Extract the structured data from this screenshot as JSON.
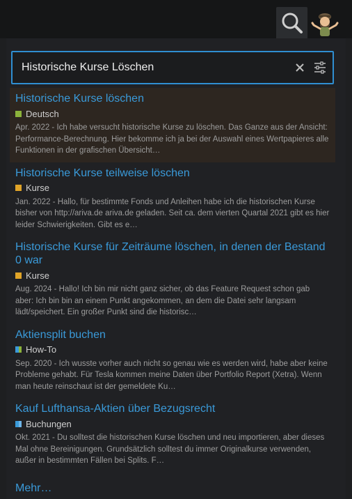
{
  "search": {
    "value": "Historische Kurse Löschen",
    "placeholder": ""
  },
  "colors": {
    "accent": "#2f8fd2",
    "link": "#3a9ad9",
    "cat_deutsch": "#8cb33b",
    "cat_kurse": "#e0a428",
    "cat_howto_a": "#3a9ad9",
    "cat_howto_b": "#8cb33b",
    "cat_buchungen_a": "#3a9ad9",
    "cat_buchungen_b": "#6fb6e8"
  },
  "results": [
    {
      "title": "Historische Kurse löschen",
      "category": "Deutsch",
      "snippet": "Apr. 2022 - Ich habe versucht historische Kurse zu löschen. Das Ganze aus der Ansicht: Performance-Berechnung. Hier bekomme ich ja bei der Auswahl eines Wertpapieres alle Funktionen in der grafischen Übersicht…"
    },
    {
      "title": "Historische Kurse teilweise löschen",
      "category": "Kurse",
      "snippet": "Jan. 2022 - Hallo, für bestimmte Fonds und Anleihen habe ich die historischen Kurse bisher von http://ariva.de ariva.de geladen. Seit ca. dem vierten Quartal 2021 gibt es hier leider Schwierigkeiten. Gibt es e…"
    },
    {
      "title": "Historische Kurse für Zeiträume löschen, in denen der Bestand 0 war",
      "category": "Kurse",
      "snippet": "Aug. 2024 - Hallo! Ich bin mir nicht ganz sicher, ob das Feature Request schon gab aber: Ich bin bin an einem Punkt angekommen, an dem die Datei sehr langsam lädt/speichert. Ein großer Punkt sind die historisc…"
    },
    {
      "title": "Aktiensplit buchen",
      "category": "How-To",
      "snippet": "Sep. 2020 - Ich wusste vorher auch nicht so genau wie es werden wird, habe aber keine Probleme gehabt. Für Tesla kommen meine Daten über Portfolio Report (Xetra). Wenn man heute reinschaut ist der gemeldete Ku…"
    },
    {
      "title": "Kauf Lufthansa-Aktien über Bezugsrecht",
      "category": "Buchungen",
      "snippet": "Okt. 2021 - Du solltest die historischen Kurse löschen und neu importieren, aber dieses Mal ohne Bereinigungen. Grundsätzlich solltest du immer Originalkurse verwenden, außer in bestimmten Fällen bei Splits. F…"
    }
  ],
  "more_label": "Mehr…"
}
